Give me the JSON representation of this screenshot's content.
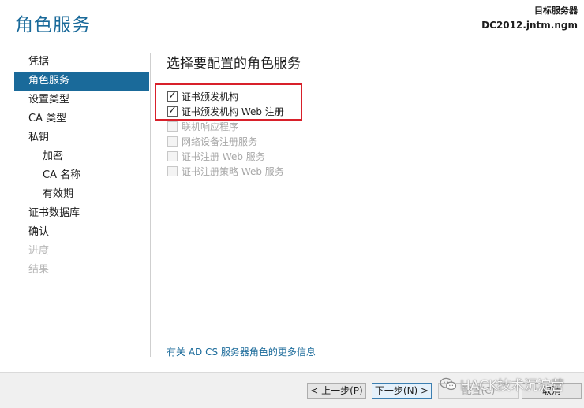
{
  "header": {
    "title": "角色服务",
    "target_label": "目标服务器",
    "target_server": "DC2012.jntm.ngm"
  },
  "nav": {
    "items": [
      {
        "label": "凭据",
        "state": "normal",
        "level": 0
      },
      {
        "label": "角色服务",
        "state": "active",
        "level": 0
      },
      {
        "label": "设置类型",
        "state": "normal",
        "level": 0
      },
      {
        "label": "CA 类型",
        "state": "normal",
        "level": 0
      },
      {
        "label": "私钥",
        "state": "normal",
        "level": 0
      },
      {
        "label": "加密",
        "state": "normal",
        "level": 1
      },
      {
        "label": "CA 名称",
        "state": "normal",
        "level": 1
      },
      {
        "label": "有效期",
        "state": "normal",
        "level": 1
      },
      {
        "label": "证书数据库",
        "state": "normal",
        "level": 0
      },
      {
        "label": "确认",
        "state": "normal",
        "level": 0
      },
      {
        "label": "进度",
        "state": "disabled",
        "level": 0
      },
      {
        "label": "结果",
        "state": "disabled",
        "level": 0
      }
    ]
  },
  "main": {
    "section_title": "选择要配置的角色服务",
    "roles": [
      {
        "label": "证书颁发机构",
        "checked": true,
        "enabled": true
      },
      {
        "label": "证书颁发机构 Web 注册",
        "checked": true,
        "enabled": true
      },
      {
        "label": "联机响应程序",
        "checked": false,
        "enabled": false
      },
      {
        "label": "网络设备注册服务",
        "checked": false,
        "enabled": false
      },
      {
        "label": "证书注册 Web 服务",
        "checked": false,
        "enabled": false
      },
      {
        "label": "证书注册策略 Web 服务",
        "checked": false,
        "enabled": false
      }
    ],
    "more_info_link": "有关 AD CS 服务器角色的更多信息"
  },
  "footer": {
    "prev_label": "< 上一步(P)",
    "next_label": "下一步(N) >",
    "install_label": "配置(C)",
    "cancel_label": "取消"
  },
  "watermark": {
    "text": "HACK技术沉淀营",
    "icon": "wechat-icon"
  },
  "colors": {
    "accent": "#1a6a9a",
    "highlight_box": "#d8202a",
    "disabled_text": "#b8b8b8"
  }
}
